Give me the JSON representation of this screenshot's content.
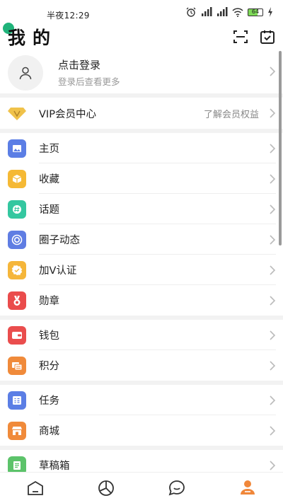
{
  "status": {
    "time": "半夜12:29",
    "battery": "64"
  },
  "header": {
    "title": "我的"
  },
  "login": {
    "title": "点击登录",
    "subtitle": "登录后查看更多"
  },
  "vip": {
    "label": "VIP会员中心",
    "extra": "了解会员权益"
  },
  "group1": [
    {
      "label": "主页",
      "icon": "image-icon",
      "color": "#5b7ee5"
    },
    {
      "label": "收藏",
      "icon": "cube-icon",
      "color": "#f5b935"
    },
    {
      "label": "话题",
      "icon": "hashtag-icon",
      "color": "#34c7a0"
    },
    {
      "label": "圈子动态",
      "icon": "circle-icon",
      "color": "#5f7de3"
    },
    {
      "label": "加V认证",
      "icon": "badge-check-icon",
      "color": "#f5b63a"
    },
    {
      "label": "勋章",
      "icon": "medal-icon",
      "color": "#ea4c4c"
    }
  ],
  "group2": [
    {
      "label": "钱包",
      "icon": "wallet-icon",
      "color": "#ea4d4d"
    },
    {
      "label": "积分",
      "icon": "coins-icon",
      "color": "#f08a3a"
    }
  ],
  "group3": [
    {
      "label": "任务",
      "icon": "task-icon",
      "color": "#5b7ee5"
    },
    {
      "label": "商城",
      "icon": "shop-icon",
      "color": "#f08a3a"
    }
  ],
  "group4": [
    {
      "label": "草稿箱",
      "icon": "draft-icon",
      "color": "#5cc36a"
    }
  ]
}
